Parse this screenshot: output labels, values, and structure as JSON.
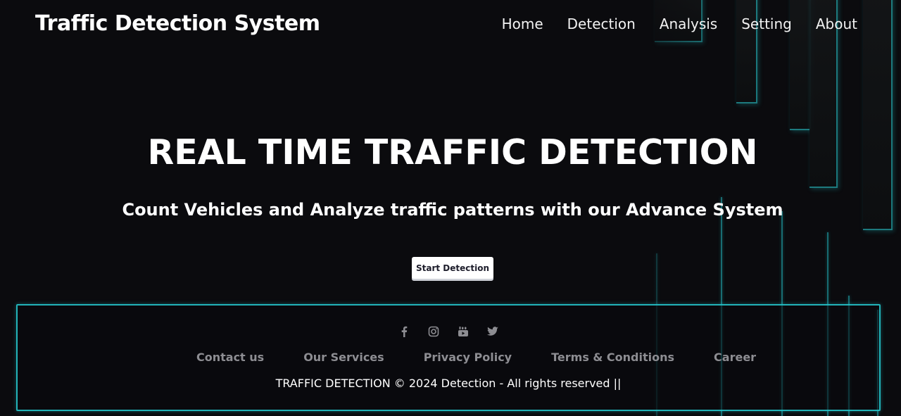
{
  "header": {
    "brand": "Traffic Detection System",
    "nav": [
      {
        "label": "Home"
      },
      {
        "label": "Detection"
      },
      {
        "label": "Analysis"
      },
      {
        "label": "Setting"
      },
      {
        "label": "About"
      }
    ]
  },
  "hero": {
    "title": "REAL TIME TRAFFIC DETECTION",
    "subtitle": "Count Vehicles and Analyze traffic patterns with our Advance System",
    "cta_label": "Start Detection"
  },
  "footer": {
    "social_icons": [
      "facebook-icon",
      "instagram-icon",
      "youtube-icon",
      "twitter-icon"
    ],
    "links": [
      {
        "label": "Contact us"
      },
      {
        "label": "Our Services"
      },
      {
        "label": "Privacy Policy"
      },
      {
        "label": "Terms & Conditions"
      },
      {
        "label": "Career"
      }
    ],
    "copyright": "TRAFFIC DETECTION © 2024 Detection - All rights reserved ||"
  },
  "colors": {
    "background": "#0b0b0e",
    "accent_neon": "#26ced6",
    "text_primary": "#ffffff",
    "text_muted": "#8d8d92"
  }
}
